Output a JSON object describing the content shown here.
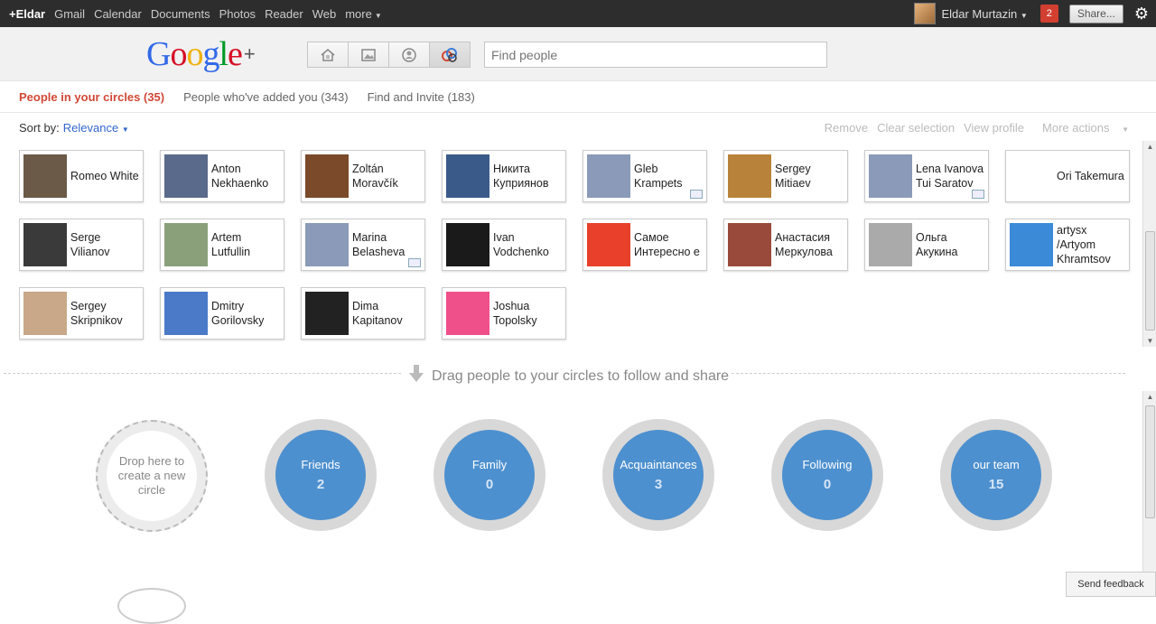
{
  "topbar": {
    "links": [
      {
        "label": "+Eldar",
        "plus": true
      },
      {
        "label": "Gmail"
      },
      {
        "label": "Calendar"
      },
      {
        "label": "Documents"
      },
      {
        "label": "Photos"
      },
      {
        "label": "Reader"
      },
      {
        "label": "Web"
      },
      {
        "label": "more",
        "caret": true
      }
    ],
    "user": "Eldar Murtazin",
    "notifications": "2",
    "share_label": "Share...",
    "gear_icon": "gear-icon"
  },
  "header": {
    "logo_plus": "+",
    "search_placeholder": "Find people",
    "mode_icons": [
      "home-icon",
      "photos-icon",
      "profile-icon",
      "circles-icon"
    ]
  },
  "tabs": [
    {
      "label": "People in your circles (35)",
      "active": true
    },
    {
      "label": "People who've added you (343)"
    },
    {
      "label": "Find and Invite (183)"
    }
  ],
  "sort": {
    "label": "Sort by:",
    "value": "Relevance"
  },
  "actions": [
    "Remove",
    "Clear selection",
    "View profile",
    "More actions"
  ],
  "people": [
    {
      "name": "Romeo White",
      "color": "#6b5a48"
    },
    {
      "name": "Anton Nekhaenko",
      "color": "#5a6a8a"
    },
    {
      "name": "Zoltán Moravčík",
      "color": "#7a4a2a"
    },
    {
      "name": "Никита Куприянов",
      "color": "#3a5a8a"
    },
    {
      "name": "Gleb Krampets",
      "color": "#8a9ab8",
      "mail": true
    },
    {
      "name": "Sergey Mitiaev",
      "color": "#b8823a"
    },
    {
      "name": "Lena Ivanova Tui Saratov",
      "color": "#8a9ab8",
      "mail": true
    },
    {
      "name": "Ori Takemura",
      "color": "#ffffff"
    },
    {
      "name": "Serge Vilianov",
      "color": "#3a3a3a"
    },
    {
      "name": "Artem Lutfullin",
      "color": "#8aa07a"
    },
    {
      "name": "Marina Belasheva",
      "color": "#8a9ab8",
      "mail": true
    },
    {
      "name": "Ivan Vodchenko",
      "color": "#1a1a1a"
    },
    {
      "name": "Самое Интересно е",
      "color": "#e8402a"
    },
    {
      "name": "Анастасия Меркулова",
      "color": "#9a4a3a"
    },
    {
      "name": "Ольга Акукина",
      "color": "#aaaaaa"
    },
    {
      "name": "artysx /Artyom Khramtsov",
      "color": "#3a8ad8"
    },
    {
      "name": "Sergey Skripnikov",
      "color": "#c8a888"
    },
    {
      "name": "Dmitry Gorilovsky",
      "color": "#4a7ac8"
    },
    {
      "name": "Dima Kapitanov",
      "color": "#222222"
    },
    {
      "name": "Joshua Topolsky",
      "color": "#f0508a"
    }
  ],
  "drag_hint": "Drag people to your circles to follow and share",
  "new_circle": "Drop here to create a new circle",
  "circles": [
    {
      "name": "Friends",
      "count": "2"
    },
    {
      "name": "Family",
      "count": "0"
    },
    {
      "name": "Acquaintances",
      "count": "3"
    },
    {
      "name": "Following",
      "count": "0"
    },
    {
      "name": "our team",
      "count": "15"
    }
  ],
  "feedback": "Send feedback"
}
